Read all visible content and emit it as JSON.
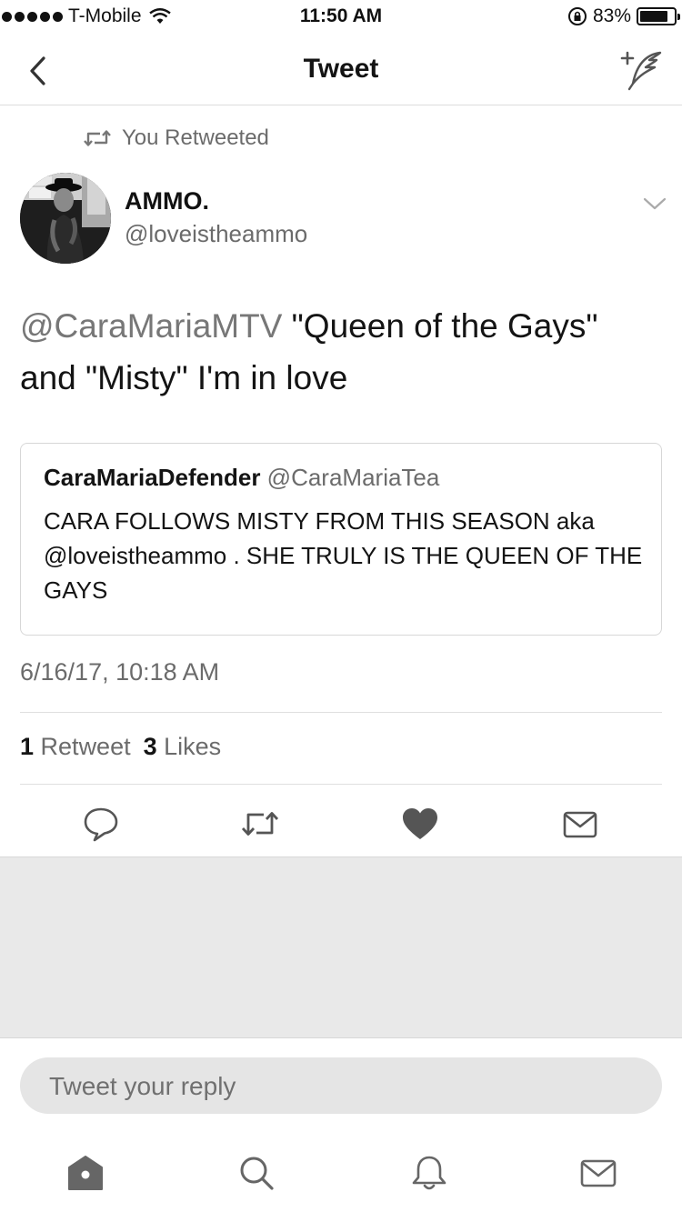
{
  "status_bar": {
    "carrier": "T-Mobile",
    "time": "11:50 AM",
    "battery_percent": "83%",
    "battery_level": 0.83,
    "icons": [
      "signal-dots-icon",
      "wifi-icon",
      "orientation-lock-icon",
      "battery-icon"
    ]
  },
  "nav": {
    "title": "Tweet",
    "back_icon": "chevron-left-icon",
    "compose_icon": "compose-tweet-icon"
  },
  "tweet": {
    "retweet_label": "You Retweeted",
    "display_name": "AMMO.",
    "handle": "@loveistheammo",
    "mention": "@CaraMariaMTV",
    "body": " \"Queen of the Gays\" and \"Misty\" I'm in love",
    "timestamp": "6/16/17, 10:18 AM",
    "retweet_count": "1",
    "retweet_label_count": "Retweet",
    "like_count": "3",
    "like_label": "Likes"
  },
  "quoted_tweet": {
    "name": "CaraMariaDefender",
    "handle": "@CaraMariaTea",
    "text": "CARA FOLLOWS MISTY FROM THIS SEASON aka @loveistheammo . SHE TRULY IS THE QUEEN OF THE GAYS"
  },
  "actions": [
    "reply-icon",
    "retweet-icon",
    "like-icon",
    "message-icon"
  ],
  "reply": {
    "placeholder": "Tweet your reply"
  },
  "tabbar": [
    "home-icon",
    "search-icon",
    "notifications-icon",
    "messages-icon"
  ],
  "colors": {
    "text": "#141414",
    "muted": "#6b6b6b",
    "divider": "#e0e0e0",
    "grey_area": "#e9e9e9",
    "reply_box": "#e5e5e5"
  }
}
